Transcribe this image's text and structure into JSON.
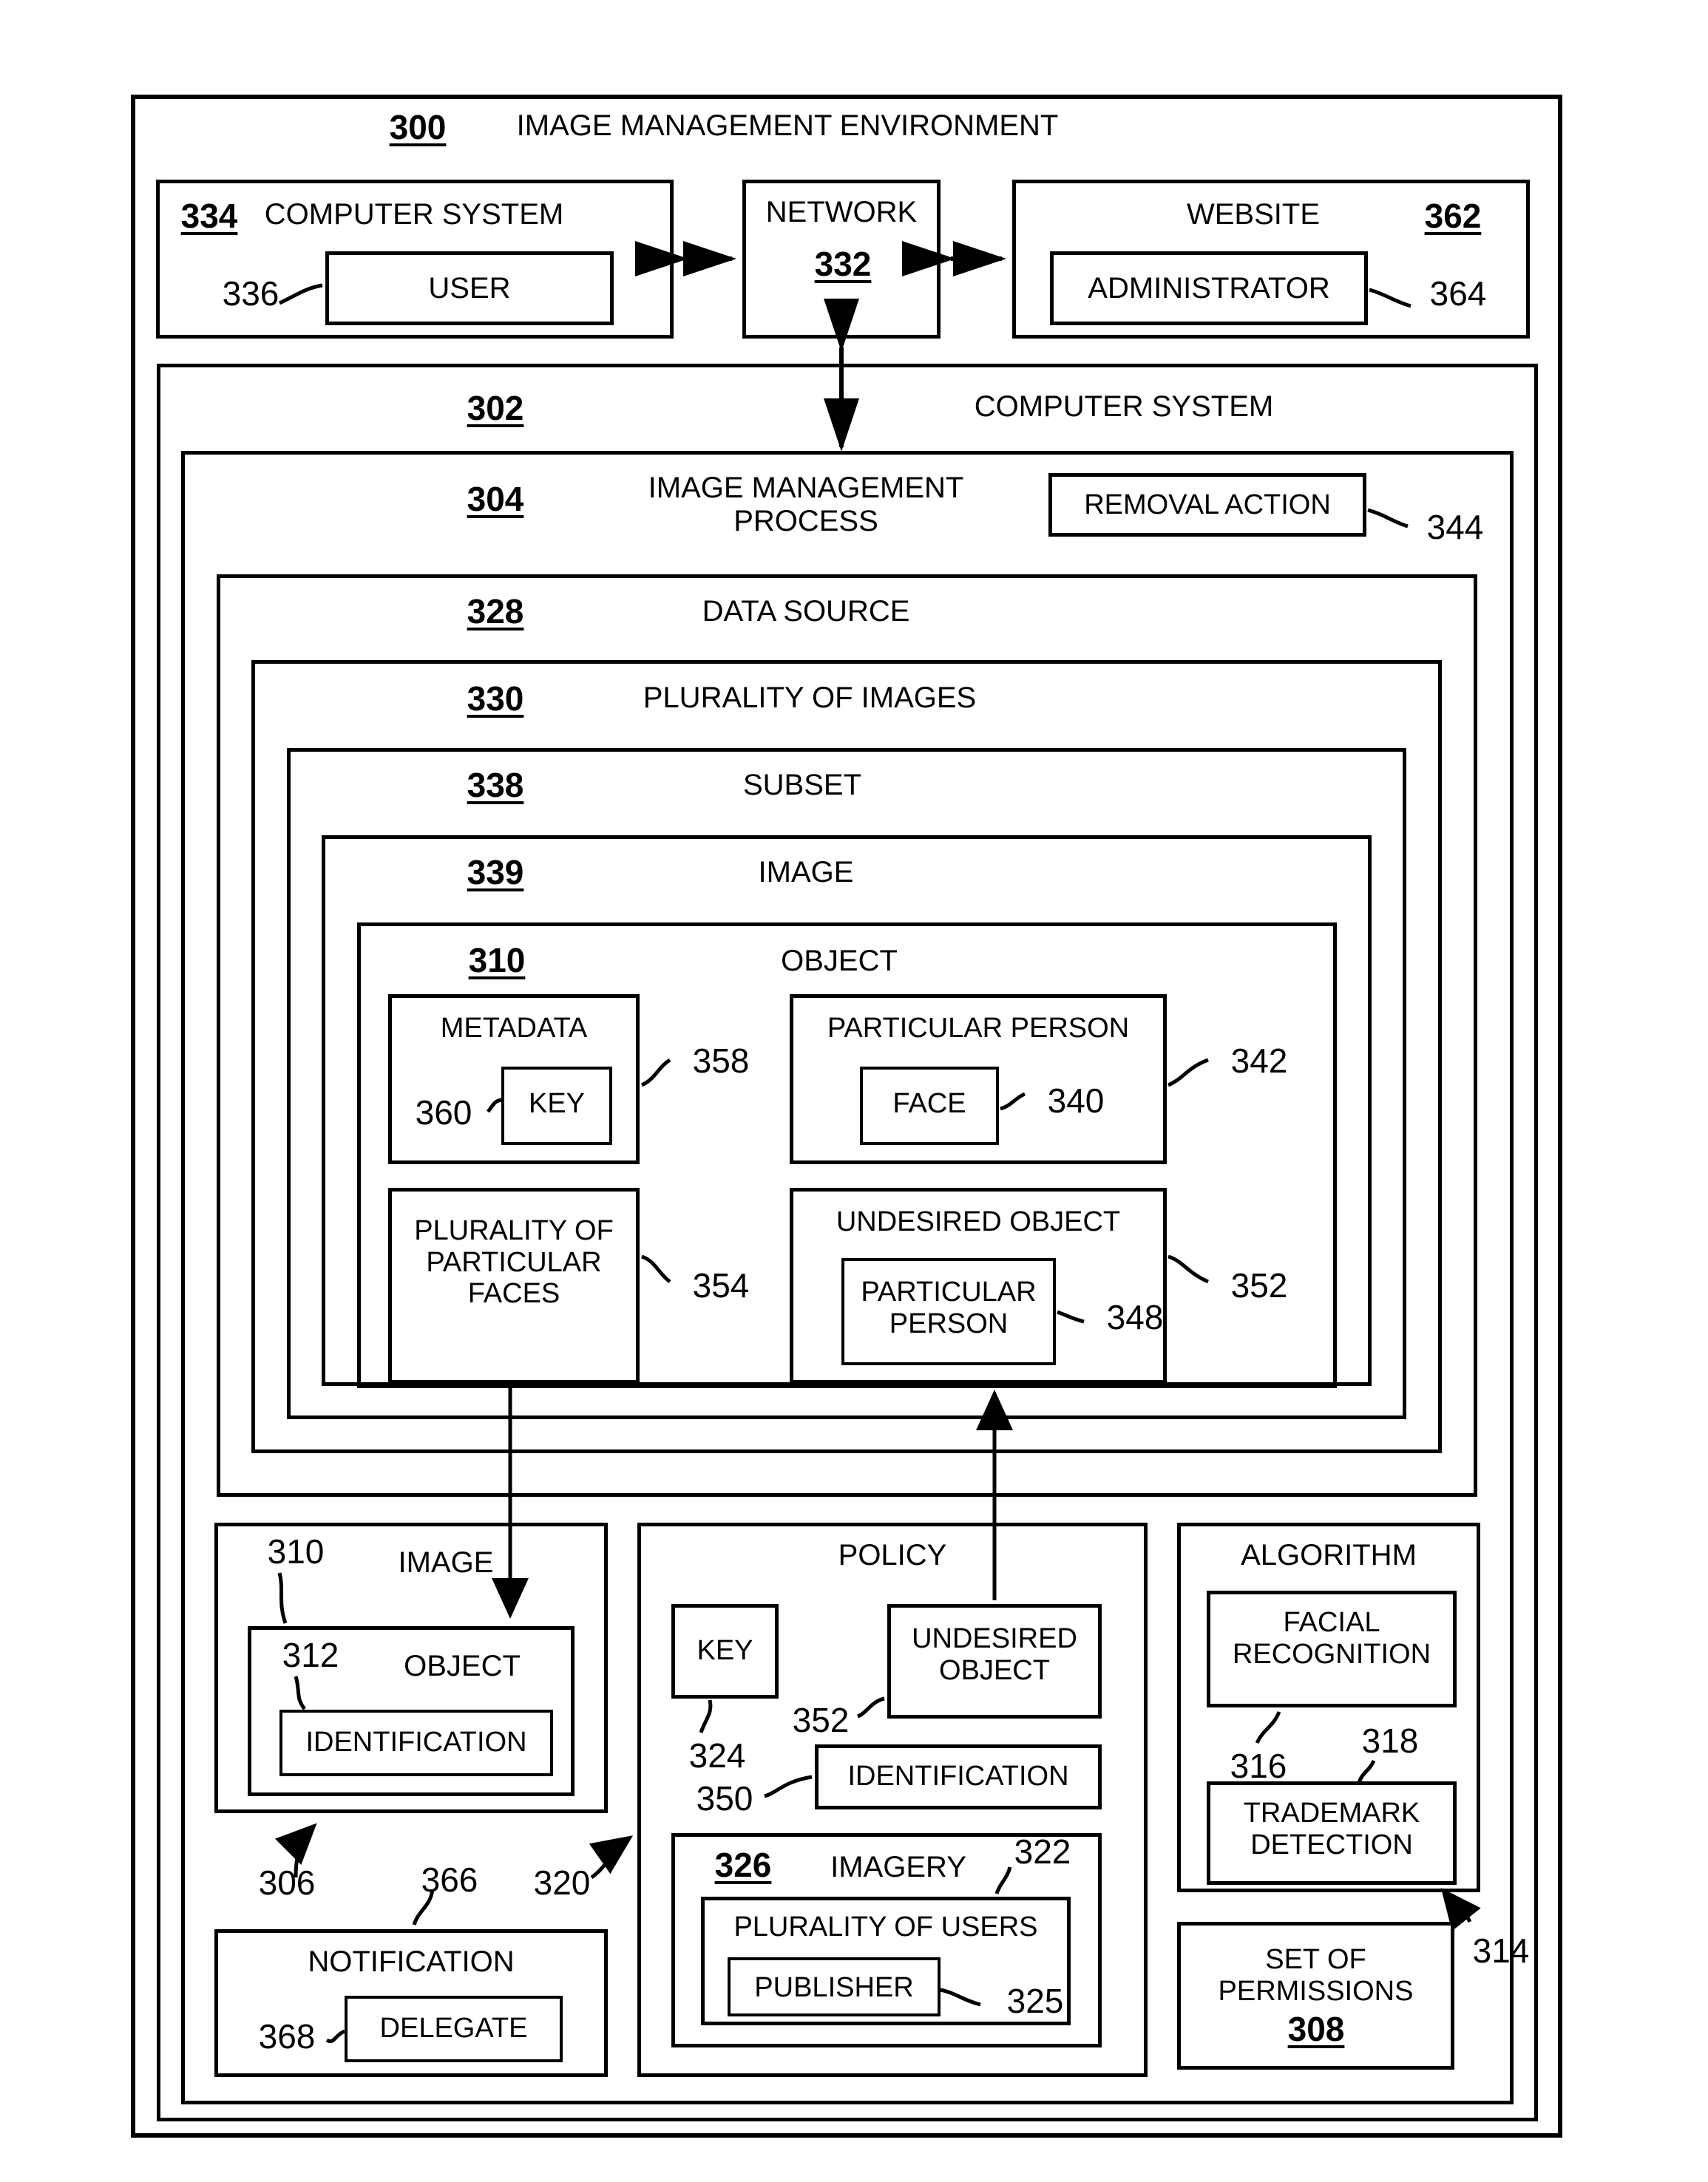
{
  "figure": {
    "title": "IMAGE MANAGEMENT ENVIRONMENT",
    "title_ref": "300"
  },
  "top_row": {
    "computer_system": {
      "ref": "334",
      "label": "COMPUTER SYSTEM",
      "user": {
        "label": "USER",
        "ref": "336"
      }
    },
    "network": {
      "label": "NETWORK",
      "ref": "332"
    },
    "website": {
      "ref": "362",
      "label": "WEBSITE",
      "administrator": {
        "label": "ADMINISTRATOR",
        "ref": "364"
      }
    }
  },
  "computer_system_2": {
    "ref": "302",
    "label": "COMPUTER SYSTEM"
  },
  "image_management_process": {
    "ref": "304",
    "label": "IMAGE MANAGEMENT\nPROCESS",
    "removal_action": {
      "label": "REMOVAL ACTION",
      "ref": "344"
    }
  },
  "data_source": {
    "ref": "328",
    "label": "DATA SOURCE"
  },
  "plurality_of_images": {
    "ref": "330",
    "label": "PLURALITY OF IMAGES"
  },
  "subset": {
    "ref": "338",
    "label": "SUBSET"
  },
  "image_339": {
    "ref": "339",
    "label": "IMAGE"
  },
  "object_310": {
    "ref": "310",
    "label": "OBJECT",
    "metadata": {
      "label": "METADATA",
      "ref": "358",
      "key": {
        "label": "KEY",
        "ref": "360"
      }
    },
    "particular_person": {
      "label": "PARTICULAR PERSON",
      "ref": "342",
      "face": {
        "label": "FACE",
        "ref": "340"
      }
    },
    "plurality_of_particular_faces": {
      "label": "PLURALITY OF\nPARTICULAR\nFACES",
      "ref": "354"
    },
    "undesired_object": {
      "label": "UNDESIRED OBJECT",
      "ref": "352",
      "particular_person": {
        "label": "PARTICULAR\nPERSON",
        "ref": "348"
      }
    }
  },
  "bottom": {
    "image_panel": {
      "ref": "310",
      "label": "IMAGE",
      "arrow_ref": "306",
      "object": {
        "ref": "312",
        "label": "OBJECT",
        "identification": {
          "label": "IDENTIFICATION"
        }
      }
    },
    "notification": {
      "label": "NOTIFICATION",
      "ref": "366",
      "delegate": {
        "label": "DELEGATE",
        "ref": "368"
      }
    },
    "policy": {
      "label": "POLICY",
      "ref": "320",
      "key": {
        "label": "KEY",
        "ref": "324"
      },
      "undesired_object": {
        "label": "UNDESIRED\nOBJECT",
        "ref": "352"
      },
      "identification": {
        "label": "IDENTIFICATION",
        "ref": "350"
      },
      "imagery": {
        "ref": "326",
        "label": "IMAGERY",
        "plurality_of_users": {
          "label": "PLURALITY OF USERS",
          "ref": "322",
          "publisher": {
            "label": "PUBLISHER",
            "ref": "325"
          }
        }
      }
    },
    "algorithm": {
      "label": "ALGORITHM",
      "ref": "314",
      "facial_recognition": {
        "label": "FACIAL\nRECOGNITION",
        "ref": "316"
      },
      "trademark_detection": {
        "label": "TRADEMARK\nDETECTION",
        "ref": "318"
      },
      "set_of_permissions": {
        "label": "SET OF\nPERMISSIONS",
        "ref": "308"
      }
    }
  },
  "colors": {
    "ink": "#000000",
    "paper": "#ffffff"
  }
}
